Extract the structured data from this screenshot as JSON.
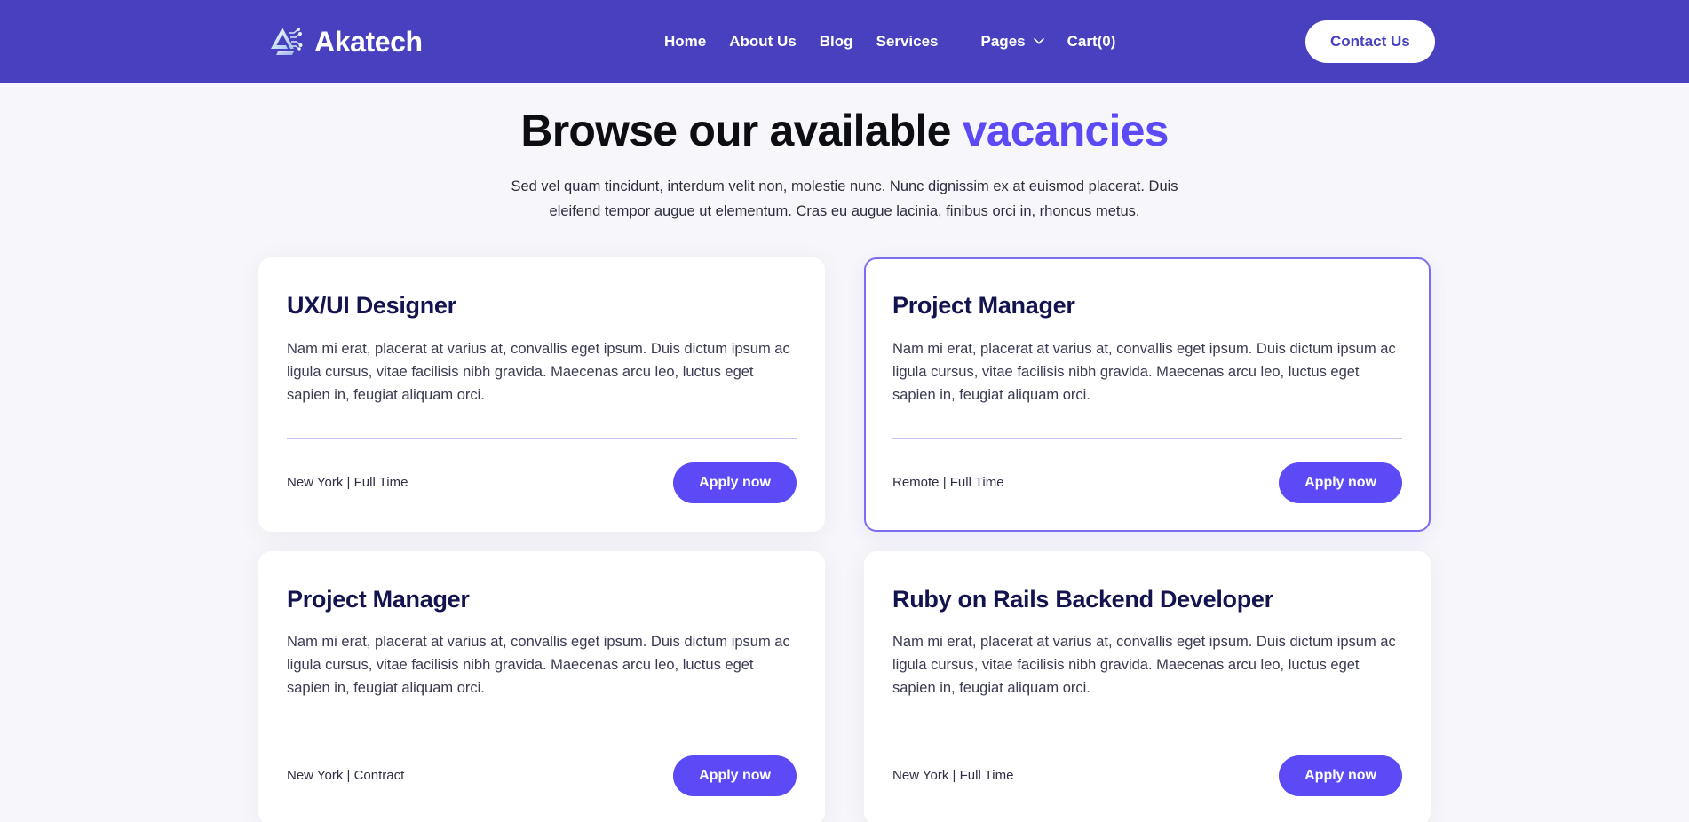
{
  "colors": {
    "header_bg": "#4840be",
    "accent": "#5b4af5",
    "card_border_active": "#7b6cf0",
    "title_navy": "#13134f",
    "page_bg": "#f7f7fb",
    "divider": "#c9c2f2"
  },
  "header": {
    "logo_icon": "akatech-triangle-circuit-logo",
    "brand": "Akatech",
    "nav": [
      {
        "label": "Home",
        "icon": "",
        "has_caret": false
      },
      {
        "label": "About Us",
        "icon": "",
        "has_caret": false
      },
      {
        "label": "Blog",
        "icon": "",
        "has_caret": false
      },
      {
        "label": "Services",
        "icon": "",
        "has_caret": false
      },
      {
        "label": "Pages",
        "icon": "chevron-down-icon",
        "has_caret": true
      },
      {
        "label": "Cart(0)",
        "icon": "",
        "has_caret": false
      }
    ],
    "contact_label": "Contact Us"
  },
  "hero": {
    "title_plain": "Browse our available ",
    "title_accent": "vacancies",
    "subtitle": "Sed vel quam tincidunt, interdum velit non, molestie nunc. Nunc dignissim ex at euismod placerat. Duis eleifend tempor augue ut elementum. Cras eu augue lacinia, finibus orci in, rhoncus metus."
  },
  "vacancies": [
    {
      "title": "UX/UI Designer",
      "description": "Nam mi erat, placerat at varius at, convallis eget ipsum. Duis dictum ipsum ac ligula cursus, vitae facilisis nibh gravida. Maecenas arcu leo, luctus eget sapien in, feugiat aliquam orci.",
      "meta": "New York | Full Time",
      "apply_label": "Apply now",
      "highlighted": false
    },
    {
      "title": "Project Manager",
      "description": "Nam mi erat, placerat at varius at, convallis eget ipsum. Duis dictum ipsum ac ligula cursus, vitae facilisis nibh gravida. Maecenas arcu leo, luctus eget sapien in, feugiat aliquam orci.",
      "meta": "Remote | Full Time",
      "apply_label": "Apply now",
      "highlighted": true
    },
    {
      "title": "Project Manager",
      "description": "Nam mi erat, placerat at varius at, convallis eget ipsum. Duis dictum ipsum ac ligula cursus, vitae facilisis nibh gravida. Maecenas arcu leo, luctus eget sapien in, feugiat aliquam orci.",
      "meta": "New York | Contract",
      "apply_label": "Apply now",
      "highlighted": false
    },
    {
      "title": "Ruby on Rails Backend Developer",
      "description": "Nam mi erat, placerat at varius at, convallis eget ipsum. Duis dictum ipsum ac ligula cursus, vitae facilisis nibh gravida. Maecenas arcu leo, luctus eget sapien in, feugiat aliquam orci.",
      "meta": "New York | Full Time",
      "apply_label": "Apply now",
      "highlighted": false
    }
  ]
}
